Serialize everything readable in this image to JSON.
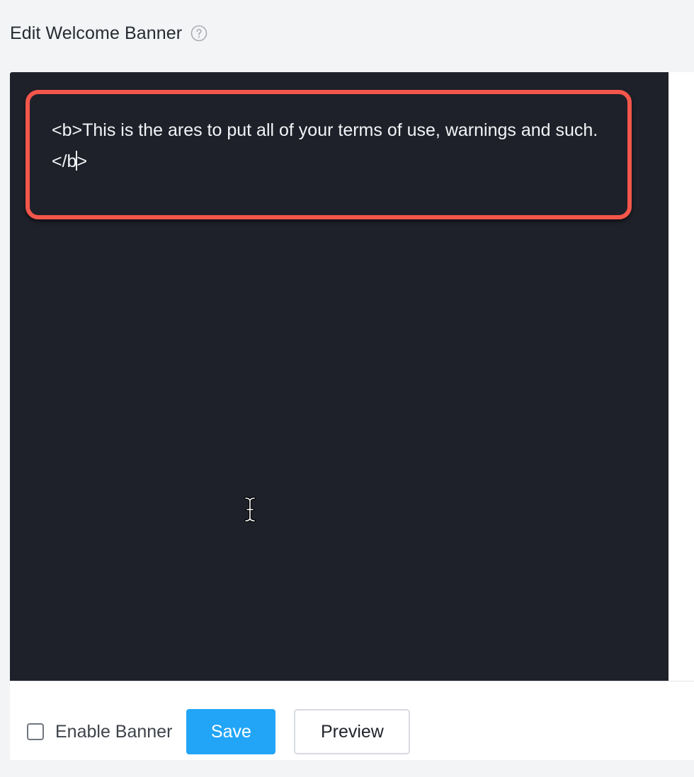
{
  "header": {
    "title": "Edit Welcome Banner",
    "help_icon": "question-circle-icon"
  },
  "editor": {
    "text_before_caret": "<b>This is the ares to put all of your terms of use, warnings and such.</b",
    "text_after_caret": ">",
    "cursor_icon": "text-ibeam-cursor-icon"
  },
  "footer": {
    "checkbox_label": "Enable Banner",
    "checkbox_checked": false,
    "save_label": "Save",
    "preview_label": "Preview"
  },
  "colors": {
    "editor_background": "#1e2129",
    "highlight": "#f4564b",
    "save_button": "#22a5f7"
  }
}
